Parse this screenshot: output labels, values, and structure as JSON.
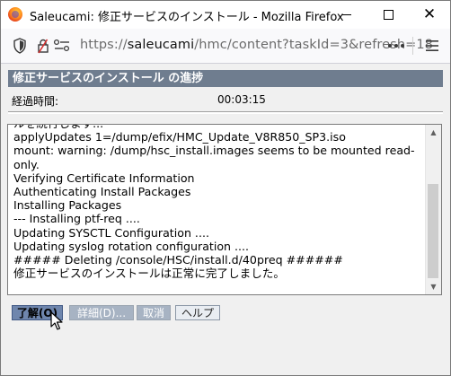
{
  "window": {
    "title": "Saleucami: 修正サービスのインストール - Mozilla Firefox",
    "controls": {
      "minimize": "minimize",
      "maximize": "maximize",
      "close": "close"
    }
  },
  "urlbar": {
    "scheme": "https://",
    "host": "saleucami",
    "path": "/hmc/content?taskId=3&refresh=18"
  },
  "panel": {
    "header": "修正サービスのインストール の進捗",
    "elapsed_label": "経過時間:",
    "elapsed_value": "00:03:15"
  },
  "log": {
    "lines": [
      "ルを続行します...",
      "applyUpdates 1=/dump/efix/HMC_Update_V8R850_SP3.iso",
      "mount: warning: /dump/hsc_install.images seems to be mounted read-",
      "only.",
      "Verifying Certificate Information",
      "Authenticating Install Packages",
      "Installing Packages",
      "--- Installing ptf-req ....",
      "Updating SYSCTL Configuration ....",
      "Updating syslog rotation configuration ....",
      "##### Deleting /console/HSC/install.d/40preq ######",
      "修正サービスのインストールは正常に完了しました。"
    ],
    "scroll_fraction": 0.6
  },
  "buttons": {
    "ok": "了解(O)",
    "details": "詳細(D)...",
    "cancel": "取消",
    "help": "ヘルプ"
  }
}
